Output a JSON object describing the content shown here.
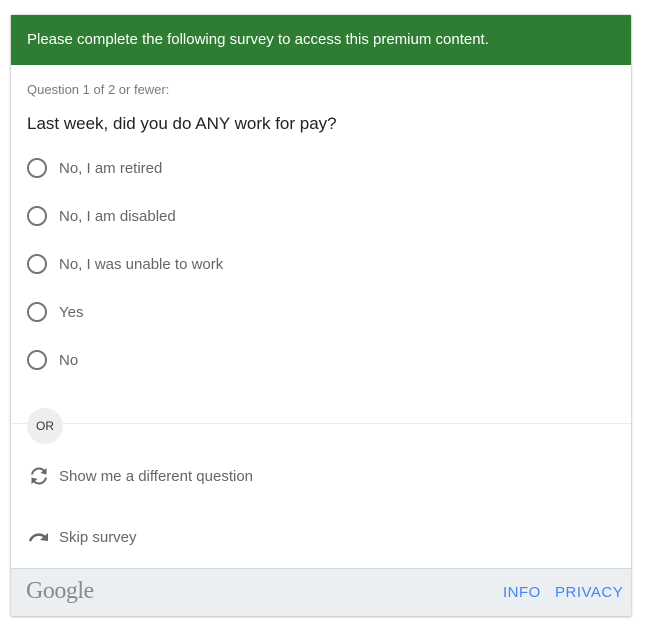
{
  "header": {
    "text": "Please complete the following survey to access this premium content."
  },
  "survey": {
    "counter": "Question 1 of 2 or fewer:",
    "question": "Last week, did you do ANY work for pay?",
    "options": [
      {
        "label": "No, I am retired"
      },
      {
        "label": "No, I am disabled"
      },
      {
        "label": "No, I was unable to work"
      },
      {
        "label": "Yes"
      },
      {
        "label": "No"
      }
    ]
  },
  "alternatives": {
    "or_label": "OR",
    "different_question": {
      "label": "Show me a different question",
      "icon": "refresh-icon"
    },
    "skip": {
      "label": "Skip survey",
      "icon": "skip-arrow-icon"
    }
  },
  "footer": {
    "logo": "Google",
    "info_link": "INFO",
    "privacy_link": "PRIVACY"
  },
  "colors": {
    "header_bg": "#2e7d32",
    "link": "#4285f4",
    "footer_bg": "#eceff1"
  }
}
